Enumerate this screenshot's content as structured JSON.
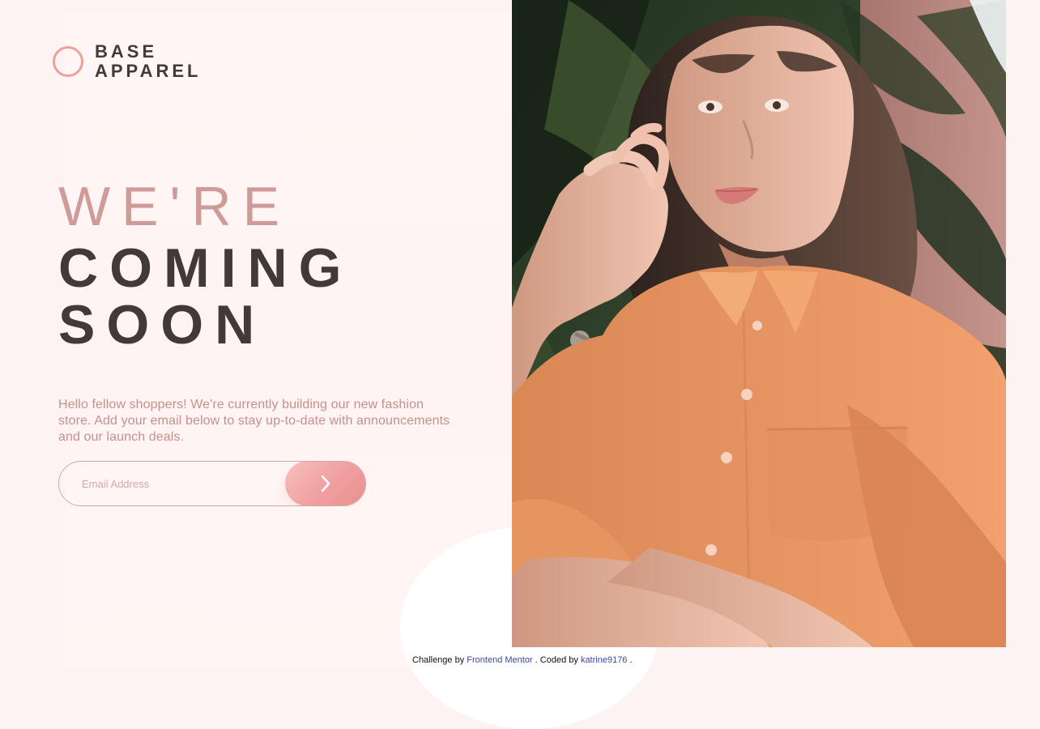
{
  "brand": {
    "line1": "BASE",
    "line2": "APPAREL"
  },
  "hero": {
    "line1": "WE'RE",
    "line2": "COMING",
    "line3": "SOON"
  },
  "description": "Hello fellow shoppers! We're currently building our new fashion store. Add your email below to stay up-to-date with announcements and our launch deals.",
  "form": {
    "email_placeholder": "Email Address",
    "submit_icon": "chevron-right-icon"
  },
  "footer": {
    "prefix": "Challenge by ",
    "link1": "Frontend Mentor",
    "middle": ". Coded by ",
    "link2": "katrine9176",
    "suffix": "."
  },
  "colors": {
    "background": "#fdf3f2",
    "accent": "#f09f9a",
    "heading": "#423a3a",
    "muted": "#cf9b98",
    "button_gradient_start": "#f8bfbf",
    "button_gradient_end": "#e98f8f",
    "link": "#3b47a8"
  },
  "icons": {
    "brand_mark": "ring-logo-icon",
    "submit": "chevron-right-icon"
  }
}
